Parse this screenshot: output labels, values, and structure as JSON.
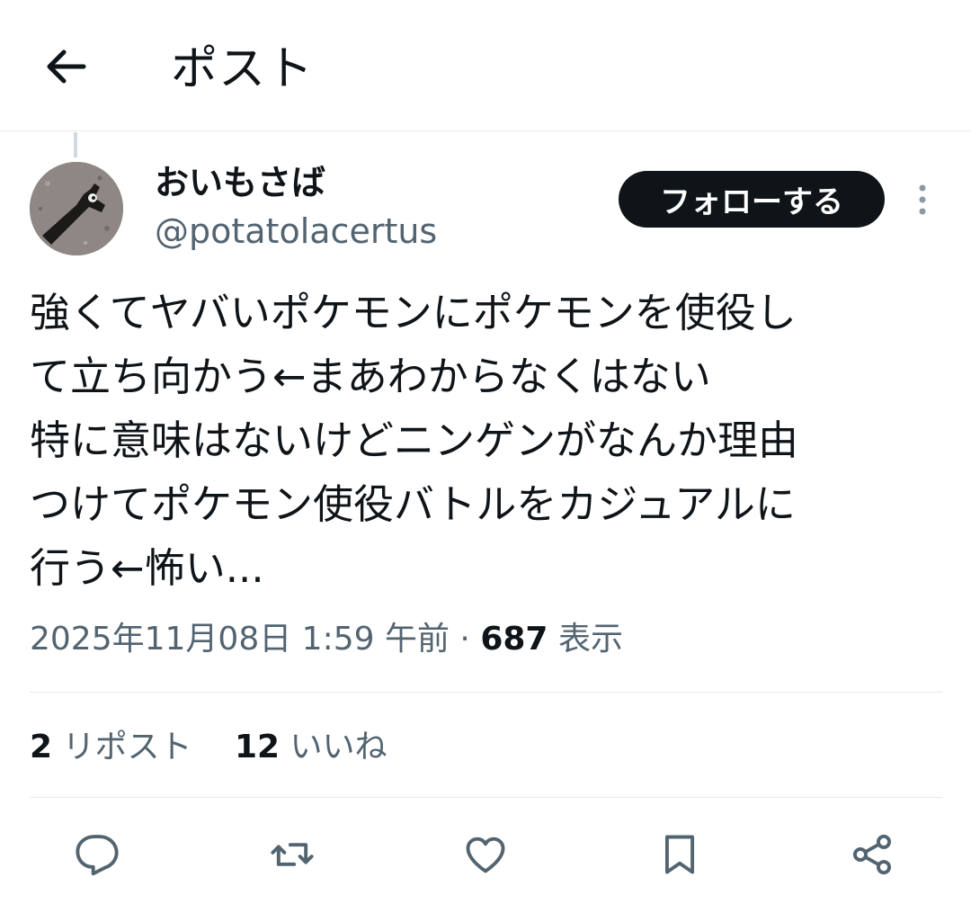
{
  "header": {
    "title": "ポスト",
    "back_icon": "arrow-left-icon"
  },
  "author": {
    "display_name": "おいもさば",
    "handle": "@potatolacertus",
    "follow_label": "フォローする"
  },
  "post": {
    "lines": [
      "強くてヤバいポケモンにポケモンを使役し",
      "て立ち向かう←まあわからなくはない",
      "特に意味はないけどニンゲンがなんか理由",
      "つけてポケモン使役バトルをカジュアルに",
      "行う←怖い..."
    ]
  },
  "meta": {
    "timestamp": "2025年11月08日 1:59 午前",
    "separator": "·",
    "views_count": "687",
    "views_label": "表示"
  },
  "stats": {
    "reposts_count": "2",
    "reposts_label": "リポスト",
    "likes_count": "12",
    "likes_label": "いいね"
  },
  "actions": [
    "reply-icon",
    "repost-icon",
    "like-icon",
    "bookmark-icon",
    "share-icon"
  ],
  "colors": {
    "text_primary": "#0f1419",
    "text_secondary": "#536471",
    "divider": "#e6e9ec",
    "follow_button_bg": "#0f1419"
  }
}
